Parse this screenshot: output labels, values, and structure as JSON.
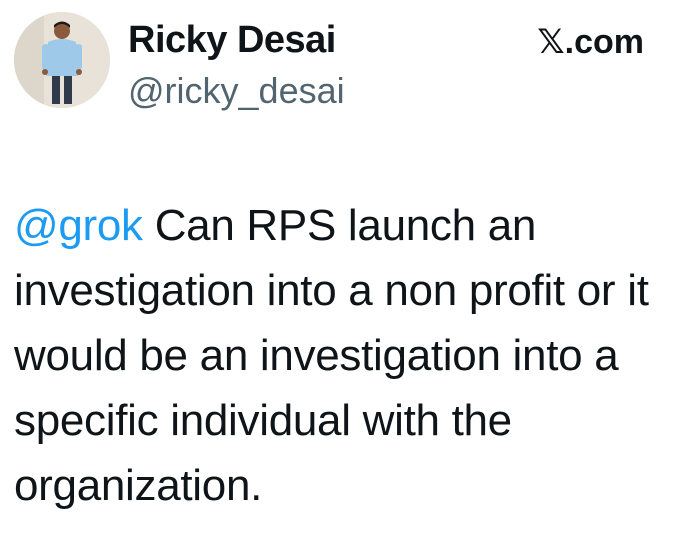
{
  "author": {
    "display_name": "Ricky Desai",
    "handle": "@ricky_desai",
    "avatar_icon": "profile-photo"
  },
  "brand": {
    "label": "𝕏.com"
  },
  "tweet": {
    "mention": "@grok",
    "text": " Can RPS launch an investigation into a non profit or it would be an investigation into a specific individual with the organization."
  },
  "colors": {
    "mention": "#1d9bf0",
    "handle": "#536471",
    "text": "#0f1419"
  }
}
